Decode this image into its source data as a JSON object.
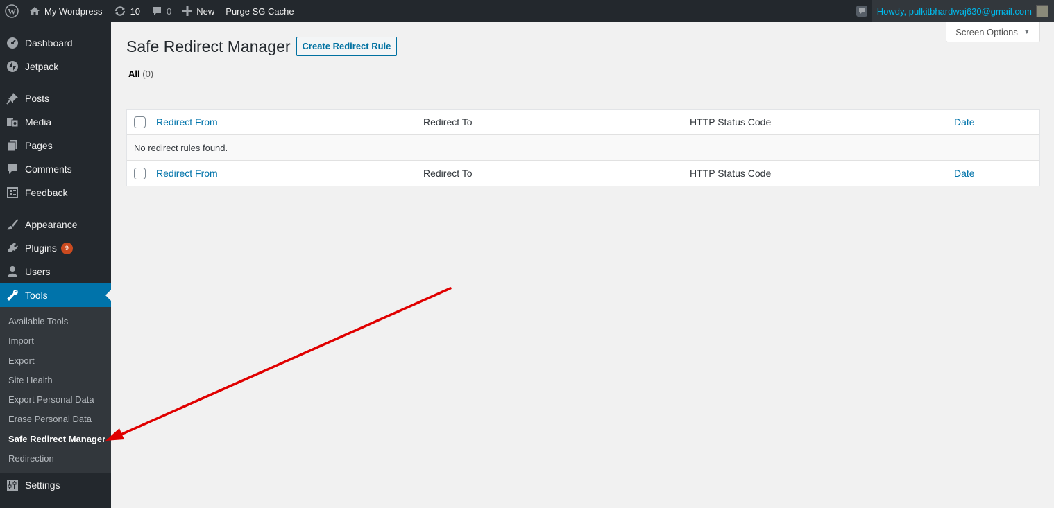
{
  "adminbar": {
    "site_name": "My Wordpress",
    "updates_count": "10",
    "comments_count": "0",
    "new_label": "New",
    "purge_label": "Purge SG Cache",
    "howdy": "Howdy, pulkitbhardwaj630@gmail.com"
  },
  "sidebar": {
    "items": [
      {
        "label": "Dashboard",
        "icon": "dashboard-icon"
      },
      {
        "label": "Jetpack",
        "icon": "jetpack-icon"
      },
      {
        "label": "Posts",
        "icon": "pin-icon"
      },
      {
        "label": "Media",
        "icon": "media-icon"
      },
      {
        "label": "Pages",
        "icon": "pages-icon"
      },
      {
        "label": "Comments",
        "icon": "comment-icon"
      },
      {
        "label": "Feedback",
        "icon": "feedback-icon"
      },
      {
        "label": "Appearance",
        "icon": "brush-icon"
      },
      {
        "label": "Plugins",
        "icon": "plug-icon",
        "badge": "9"
      },
      {
        "label": "Users",
        "icon": "user-icon"
      },
      {
        "label": "Tools",
        "icon": "wrench-icon"
      },
      {
        "label": "Settings",
        "icon": "settings-icon"
      }
    ],
    "tools_submenu": [
      "Available Tools",
      "Import",
      "Export",
      "Site Health",
      "Export Personal Data",
      "Erase Personal Data",
      "Safe Redirect Manager",
      "Redirection"
    ]
  },
  "main": {
    "screen_options": "Screen Options",
    "title": "Safe Redirect Manager",
    "add_new": "Create Redirect Rule",
    "filter_all": "All",
    "filter_all_count": "(0)",
    "columns": [
      "Redirect From",
      "Redirect To",
      "HTTP Status Code",
      "Date"
    ],
    "empty_message": "No redirect rules found."
  },
  "colors": {
    "accent": "#0073aa",
    "annotation_arrow": "#e00000",
    "badge": "#ca4a1f"
  }
}
